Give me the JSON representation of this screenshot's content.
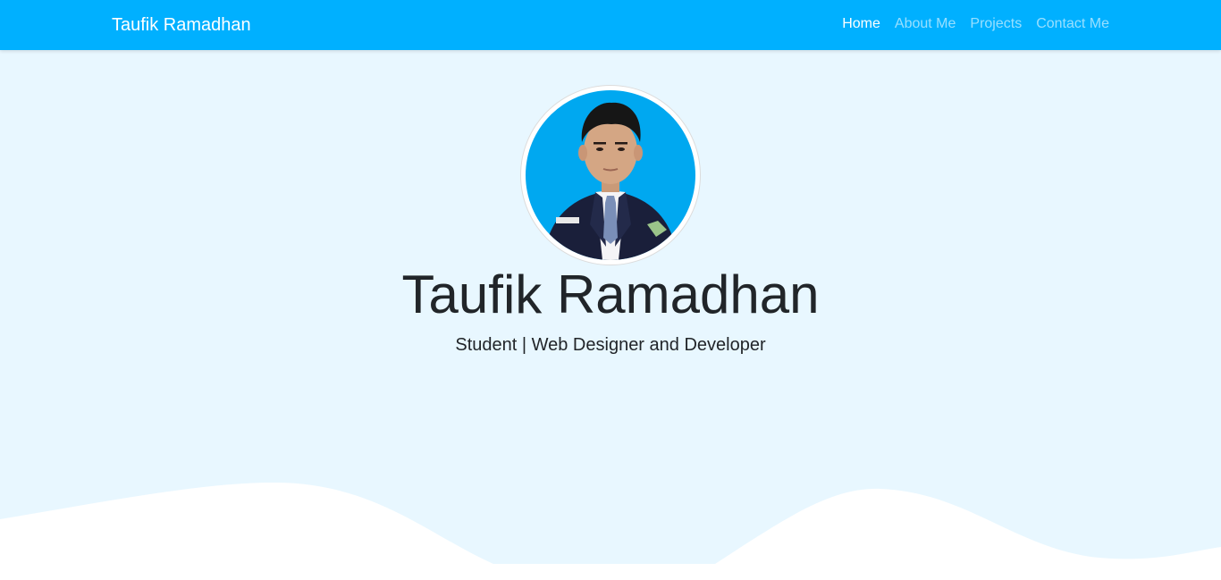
{
  "navbar": {
    "brand": "Taufik Ramadhan",
    "links": [
      {
        "label": "Home",
        "active": true
      },
      {
        "label": "About Me",
        "active": false
      },
      {
        "label": "Projects",
        "active": false
      },
      {
        "label": "Contact Me",
        "active": false
      }
    ]
  },
  "hero": {
    "avatar_icon": "profile-photo",
    "name": "Taufik Ramadhan",
    "tagline": "Student | Web Designer and Developer"
  },
  "colors": {
    "navbar_bg": "#00b0ff",
    "page_bg": "#e8f7ff",
    "wave": "#ffffff"
  }
}
